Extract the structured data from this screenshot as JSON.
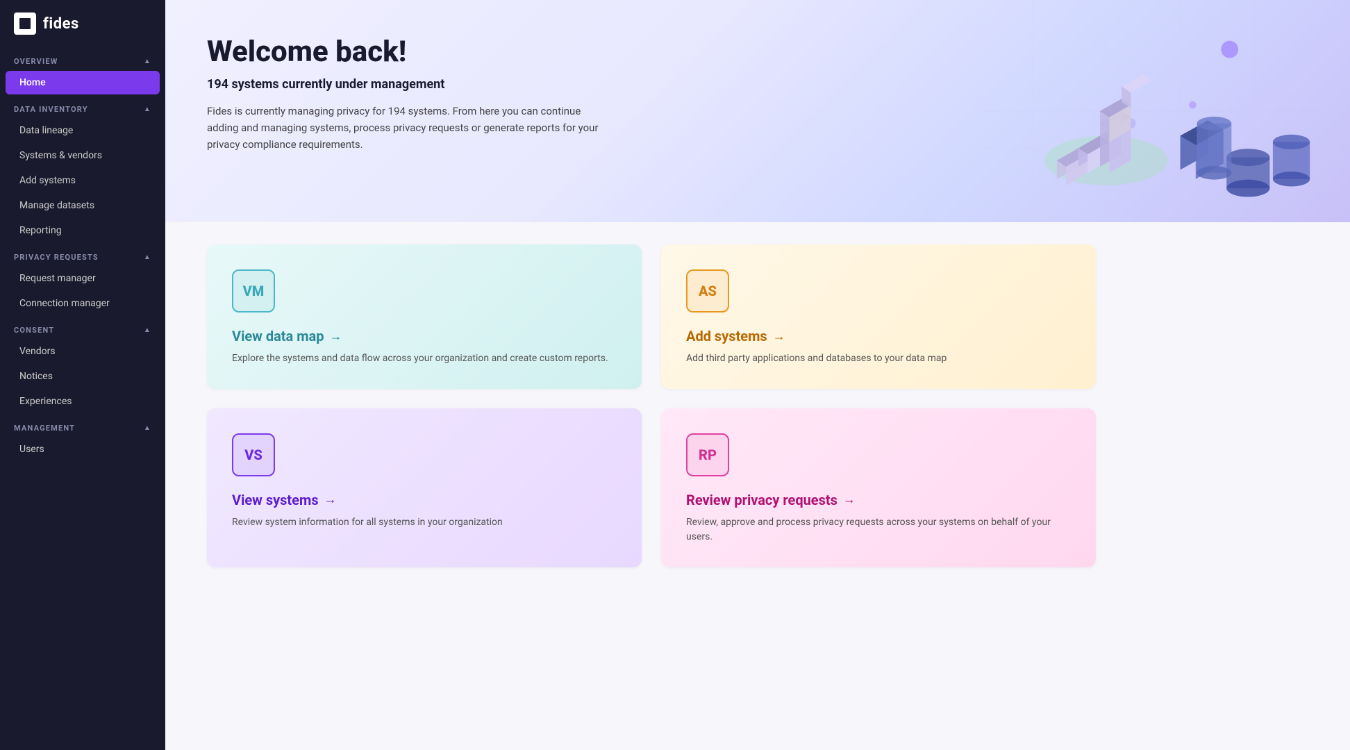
{
  "app": {
    "logo_text": "fides"
  },
  "sidebar": {
    "sections": [
      {
        "id": "overview",
        "label": "OVERVIEW",
        "items": [
          {
            "id": "home",
            "label": "Home",
            "active": true
          }
        ]
      },
      {
        "id": "data_inventory",
        "label": "DATA INVENTORY",
        "items": [
          {
            "id": "data-lineage",
            "label": "Data lineage",
            "active": false
          },
          {
            "id": "systems-vendors",
            "label": "Systems & vendors",
            "active": false
          },
          {
            "id": "add-systems",
            "label": "Add systems",
            "active": false
          },
          {
            "id": "manage-datasets",
            "label": "Manage datasets",
            "active": false
          },
          {
            "id": "reporting",
            "label": "Reporting",
            "active": false
          }
        ]
      },
      {
        "id": "privacy_requests",
        "label": "PRIVACY REQUESTS",
        "items": [
          {
            "id": "request-manager",
            "label": "Request manager",
            "active": false
          },
          {
            "id": "connection-manager",
            "label": "Connection manager",
            "active": false
          }
        ]
      },
      {
        "id": "consent",
        "label": "CONSENT",
        "items": [
          {
            "id": "vendors",
            "label": "Vendors",
            "active": false
          },
          {
            "id": "notices",
            "label": "Notices",
            "active": false
          },
          {
            "id": "experiences",
            "label": "Experiences",
            "active": false
          }
        ]
      },
      {
        "id": "management",
        "label": "MANAGEMENT",
        "items": [
          {
            "id": "users",
            "label": "Users",
            "active": false
          }
        ]
      }
    ]
  },
  "hero": {
    "title": "Welcome back!",
    "subtitle": "194 systems currently under management",
    "description": "Fides is currently managing privacy for 194 systems. From here you can continue adding and managing systems, process privacy requests or generate reports for your privacy compliance requirements."
  },
  "cards": [
    {
      "id": "vm",
      "badge": "VM",
      "badge_class": "badge-vm",
      "card_class": "card-vm",
      "title_class": "card-title-vm",
      "title": "View data map",
      "arrow": "→",
      "description": "Explore the systems and data flow across your organization and create custom reports."
    },
    {
      "id": "as",
      "badge": "AS",
      "badge_class": "badge-as",
      "card_class": "card-as",
      "title_class": "card-title-as",
      "title": "Add systems",
      "arrow": "→",
      "description": "Add third party applications and databases to your data map"
    },
    {
      "id": "vs",
      "badge": "VS",
      "badge_class": "badge-vs",
      "card_class": "card-vs",
      "title_class": "card-title-vs",
      "title": "View systems",
      "arrow": "→",
      "description": "Review system information for all systems in your organization"
    },
    {
      "id": "rp",
      "badge": "RP",
      "badge_class": "badge-rp",
      "card_class": "card-rp",
      "title_class": "card-title-rp",
      "title": "Review privacy requests",
      "arrow": "→",
      "description": "Review, approve and process privacy requests across your systems on behalf of your users."
    }
  ]
}
